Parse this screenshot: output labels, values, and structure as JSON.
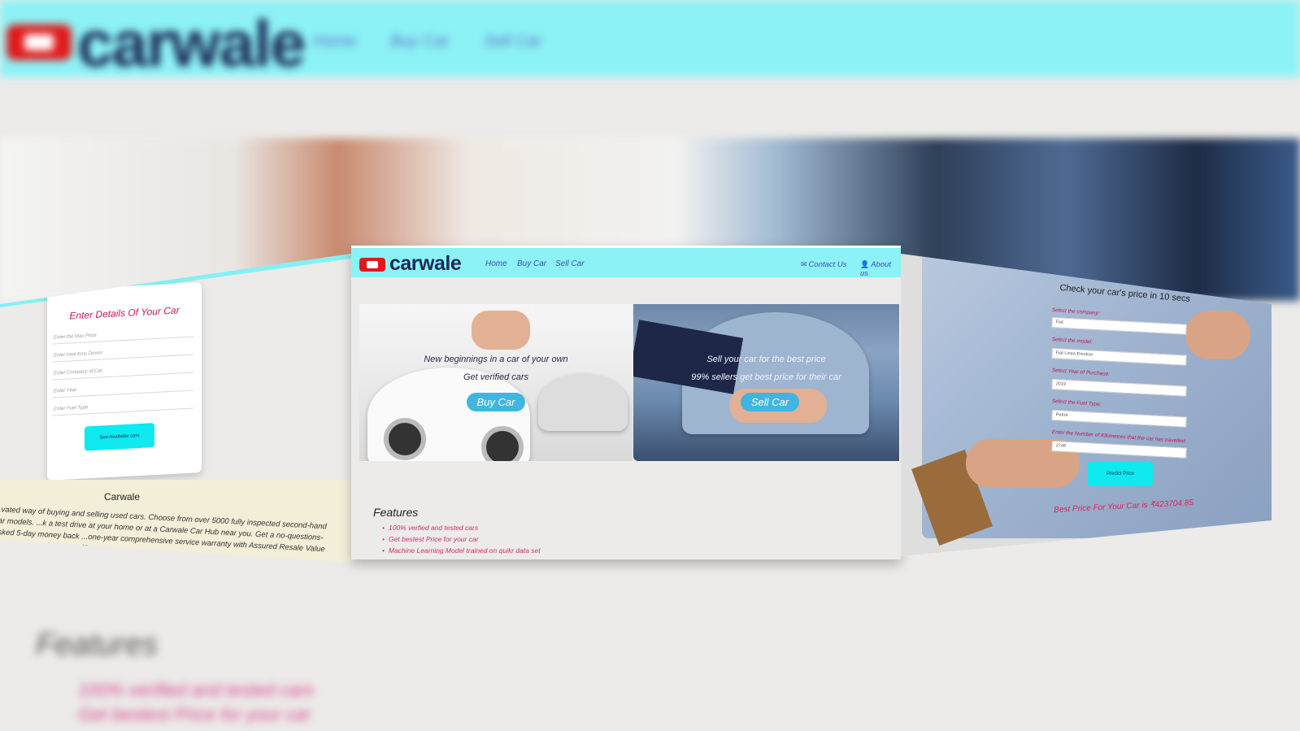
{
  "brand": {
    "name": "carwale",
    "nav_bg": "#8cf2f6",
    "logo_red": "#e01919",
    "logo_navy": "#1a2a58"
  },
  "background": {
    "nav": [
      "Home",
      "Buy Car",
      "Sell Car"
    ],
    "features_title": "Features",
    "features": [
      "100% verified and tested cars",
      "Get bestest Price for your car"
    ]
  },
  "left": {
    "card_title": "Enter Details Of Your Car",
    "fields": [
      "Enter the Max Price",
      "Enter total Kms Driven",
      "Enter Company of Car",
      "Enter Year",
      "Enter Fuel Type"
    ],
    "button": "See Available cars",
    "footer_title": "Carwale",
    "footer_text": "...vated way of buying and selling used cars. Choose from over 5000 fully inspected second-hand car models. ...k a test drive at your home or at a Carwale Car Hub near you. Get a no-questions-asked 5-day money back ...one-year comprehensive service warranty with Assured Resale Value on every Carwale Assured® car."
  },
  "center": {
    "nav": {
      "home": "Home",
      "buy": "Buy Car",
      "sell": "Sell Car",
      "contact": "Contact Us",
      "about": "About us"
    },
    "buy_panel": {
      "line1": "New beginnings in a car of your own",
      "line2": "Get verified cars",
      "button": "Buy Car"
    },
    "sell_panel": {
      "line1": "Sell your car for the best price",
      "line2": "99% sellers get best price for their car",
      "button": "Sell Car"
    },
    "features_title": "Features",
    "features": [
      "100% verfied and tested cars",
      "Get bestest Price for your car",
      "Machine Learning Model trained on quikr data set"
    ]
  },
  "right": {
    "title": "Check your car's price in 10 secs",
    "fields": [
      {
        "label": "Select the company:",
        "value": "Fiat"
      },
      {
        "label": "Select the model:",
        "value": "Fiat Linea Emotion"
      },
      {
        "label": "Select Year of Purchase:",
        "value": "2019"
      },
      {
        "label": "Select the Fuel Type:",
        "value": "Petrol"
      },
      {
        "label": "Enter the Number of Kilometres that the car has travelled:",
        "value": "2748"
      }
    ],
    "button": "Predict Price",
    "result": "Best Price For Your Car is ₹423704.85"
  },
  "icons": {
    "contact": "envelope-icon",
    "about": "user-icon"
  }
}
